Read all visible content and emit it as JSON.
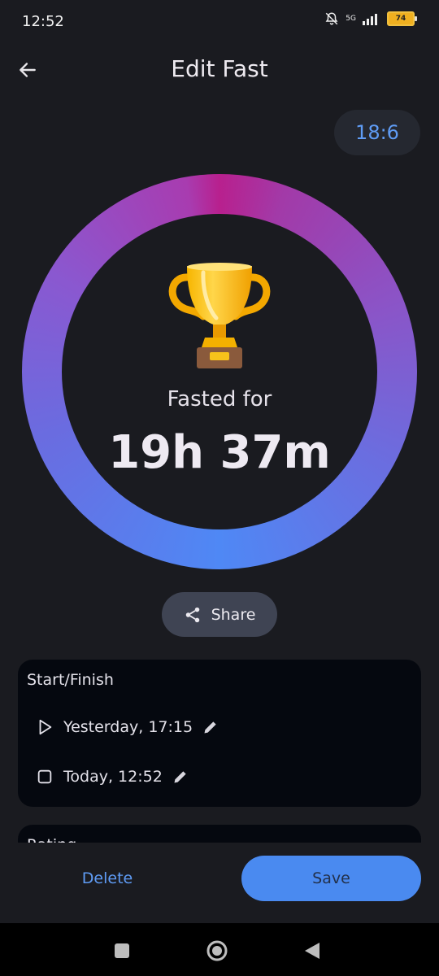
{
  "status": {
    "time": "12:52",
    "network": "5G",
    "battery": "74",
    "icons": [
      "bell-off-icon",
      "signal-icon",
      "battery-icon"
    ]
  },
  "header": {
    "title": "Edit Fast",
    "back_icon": "arrow-left-icon"
  },
  "ratio": "18:6",
  "progress": {
    "label": "Fasted for",
    "value": "19h 37m",
    "icon": "trophy-icon",
    "fraction_complete": 1.0
  },
  "share": {
    "label": "Share",
    "icon": "share-icon"
  },
  "start_finish": {
    "title": "Start/Finish",
    "start": "Yesterday, 17:15",
    "finish": "Today, 12:52",
    "start_icon": "play-icon",
    "finish_icon": "stop-icon",
    "edit_icon": "pencil-icon"
  },
  "next_card": {
    "title": "Rating"
  },
  "actions": {
    "delete": "Delete",
    "save": "Save"
  },
  "colors": {
    "background": "#1a1b20",
    "accent": "#5f9cf5",
    "save_button": "#4a8af0",
    "ring_start": "#4f88f5",
    "ring_end": "#b8208e"
  }
}
